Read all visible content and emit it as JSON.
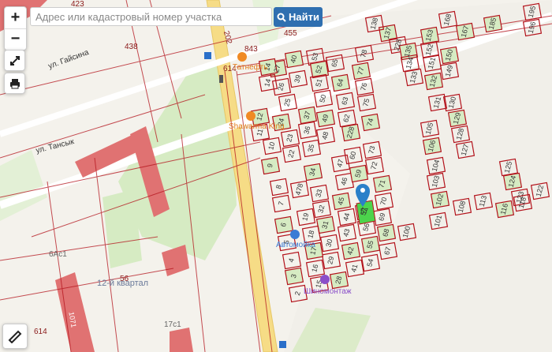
{
  "search": {
    "placeholder": "Адрес или кадастровый номер участка",
    "button_label": "Найти"
  },
  "controls": {
    "zoom_in": "+",
    "zoom_out": "−"
  },
  "map_labels": {
    "street_gaisina": "ул. Гайсина",
    "street_tansyk": "ул. Тансык",
    "quarter": "12-й квартал",
    "b_6ac1": "6Ас1",
    "b_17c1": "17с1",
    "b_1071": "1071",
    "n438": "438",
    "n614a": "614",
    "n614b": "614",
    "n843": "843",
    "n455": "455",
    "n423": "423",
    "n202": "202",
    "n56": "56"
  },
  "pois": {
    "tatneft": "Татнефть",
    "shawarma": "Shawarma King",
    "carwash": "Автомойка",
    "tire": "Шиномонтаж"
  },
  "parcels": [
    "12",
    "11",
    "10",
    "9",
    "8",
    "7",
    "6",
    "5",
    "4",
    "3",
    "2",
    "478",
    "34",
    "33",
    "32",
    "31",
    "30",
    "29",
    "28",
    "19",
    "18",
    "17",
    "16",
    "15",
    "24",
    "23",
    "22",
    "37",
    "36",
    "35",
    "27",
    "26",
    "25",
    "40",
    "39",
    "53",
    "52",
    "51",
    "50",
    "49",
    "48",
    "65",
    "64",
    "63",
    "62",
    "228",
    "47",
    "46",
    "45",
    "44",
    "43",
    "42",
    "41",
    "60",
    "59",
    "57",
    "56",
    "55",
    "54",
    "78",
    "77",
    "76",
    "75",
    "74",
    "73",
    "72",
    "71",
    "70",
    "69",
    "68",
    "67",
    "105",
    "106",
    "104",
    "103",
    "102",
    "101",
    "100",
    "137",
    "138",
    "228",
    "135",
    "134",
    "133",
    "132",
    "131",
    "130",
    "129",
    "128",
    "127",
    "153",
    "152",
    "151",
    "150",
    "149",
    "168",
    "167",
    "195",
    "196",
    "185",
    "122",
    "125",
    "124",
    "123",
    "118",
    "116",
    "113",
    "108",
    "14",
    "14"
  ],
  "selected_parcel": "57",
  "colors": {
    "accent": "#2f6fb0",
    "parcel_line": "#b3121b",
    "selected": "#4cd44c",
    "marker": "#2a80c9"
  }
}
